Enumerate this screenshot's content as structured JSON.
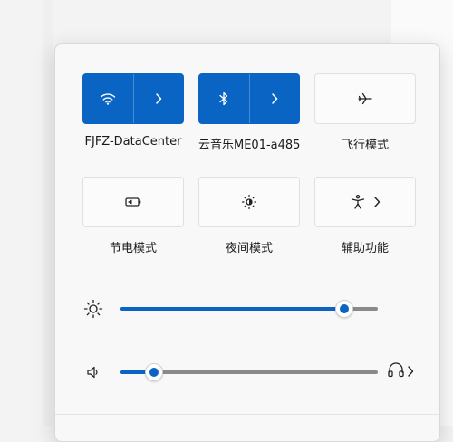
{
  "colors": {
    "accent": "#0a64c4",
    "track": "#8a8a8a",
    "tile_off_bg": "#fbfbfb",
    "panel_bg": "#f8f8f8"
  },
  "quick_settings": {
    "tiles": [
      {
        "id": "wifi",
        "label": "FJFZ-DataCenter",
        "active": true,
        "icon": "wifi-icon",
        "has_expand": true
      },
      {
        "id": "bluetooth",
        "label": "云音乐ME01-a485",
        "active": true,
        "icon": "bluetooth-icon",
        "has_expand": true
      },
      {
        "id": "airplane",
        "label": "飞行模式",
        "active": false,
        "icon": "airplane-icon",
        "has_expand": false
      },
      {
        "id": "battery-saver",
        "label": "节电模式",
        "active": false,
        "icon": "battery-saver-icon",
        "has_expand": false
      },
      {
        "id": "night-light",
        "label": "夜间模式",
        "active": false,
        "icon": "night-light-icon",
        "has_expand": false
      },
      {
        "id": "accessibility",
        "label": "辅助功能",
        "active": false,
        "icon": "accessibility-icon",
        "has_expand": true
      }
    ],
    "brightness": {
      "icon": "brightness-icon",
      "value_percent": 87
    },
    "volume": {
      "icon": "speaker-icon",
      "value_percent": 13,
      "output_icon": "headphones-icon"
    }
  }
}
